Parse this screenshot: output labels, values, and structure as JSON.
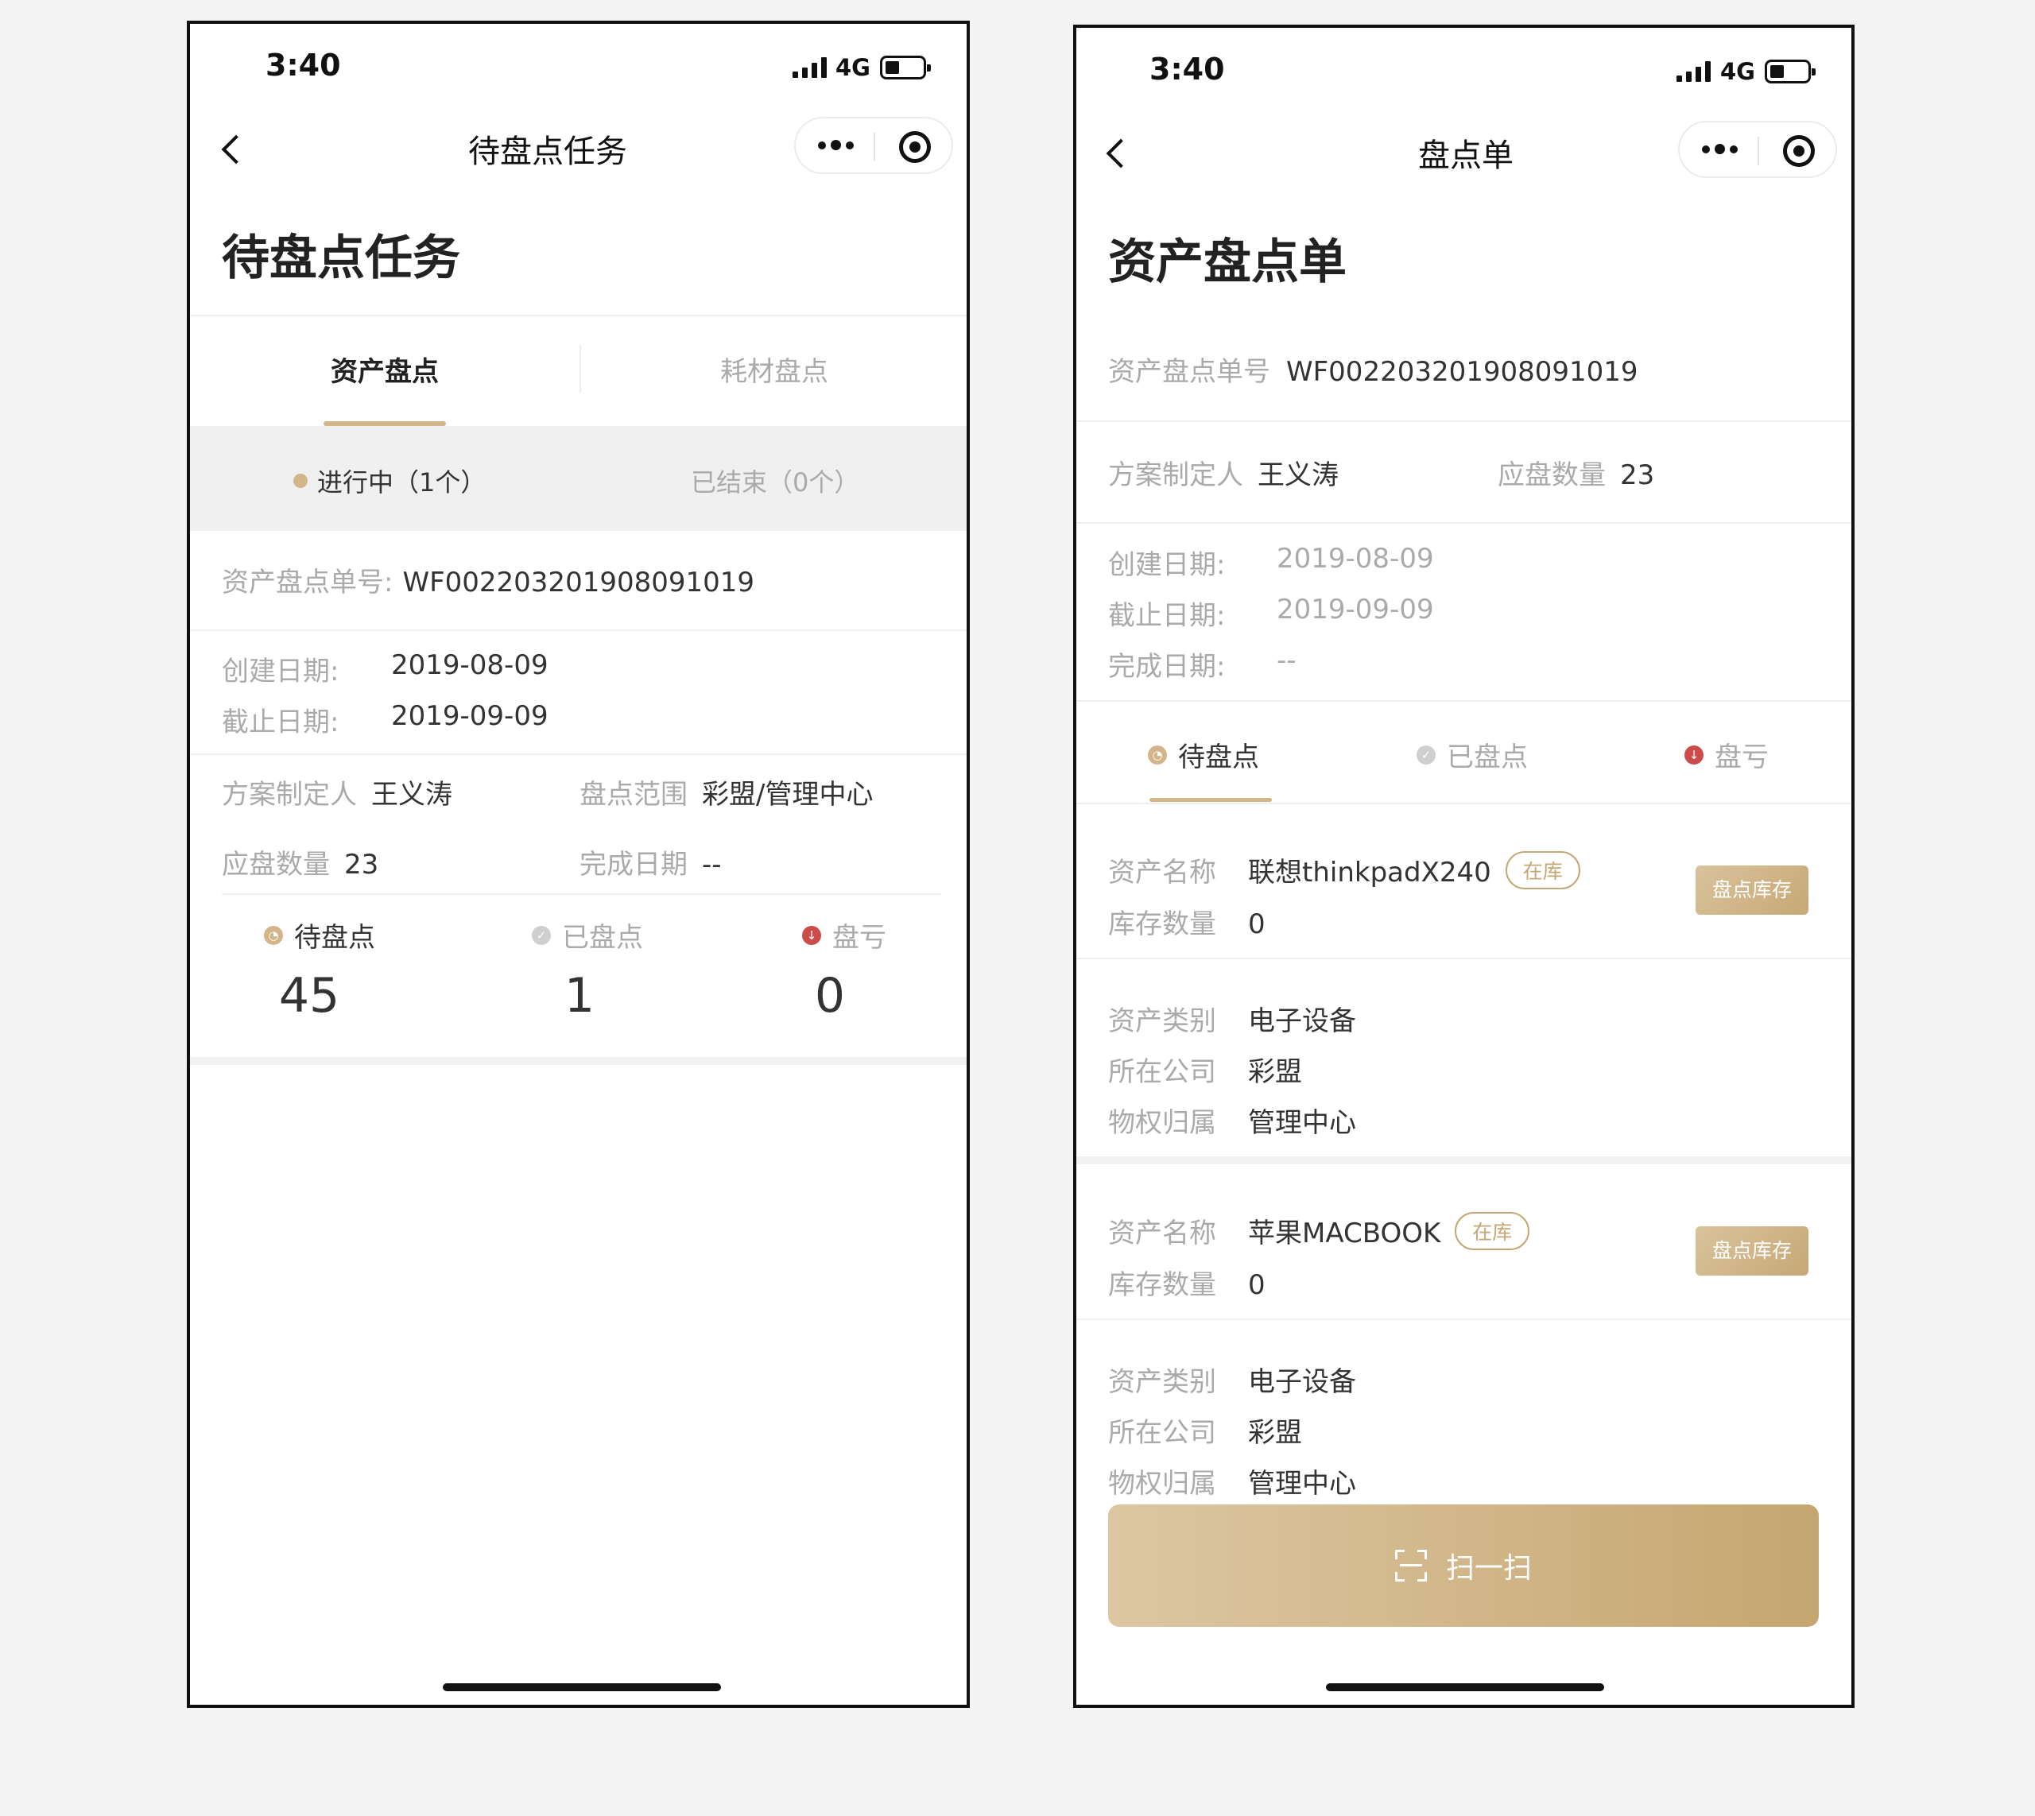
{
  "left": {
    "status": {
      "time": "3:40",
      "network": "4G"
    },
    "nav": {
      "title": "待盘点任务"
    },
    "page_title": "待盘点任务",
    "tabs": [
      {
        "label": "资产盘点"
      },
      {
        "label": "耗材盘点"
      }
    ],
    "filters": [
      {
        "label": "进行中（1个）"
      },
      {
        "label": "已结束（0个）"
      }
    ],
    "order": {
      "label": "资产盘点单号:",
      "value": "WF002203201908091019"
    },
    "created": {
      "label": "创建日期:",
      "value": "2019-08-09"
    },
    "deadline": {
      "label": "截止日期:",
      "value": "2019-09-09"
    },
    "planner": {
      "label": "方案制定人",
      "value": "王义涛"
    },
    "scope": {
      "label": "盘点范围",
      "value": "彩盟/管理中心"
    },
    "quantity": {
      "label": "应盘数量",
      "value": "23"
    },
    "finished": {
      "label": "完成日期",
      "value": "--"
    },
    "stats": [
      {
        "label": "待盘点",
        "value": "45",
        "color": "#d2b68a"
      },
      {
        "label": "已盘点",
        "value": "1",
        "color": "#cfcfcf"
      },
      {
        "label": "盘亏",
        "value": "0",
        "color": "#cc4b4b"
      }
    ]
  },
  "right": {
    "status": {
      "time": "3:40",
      "network": "4G"
    },
    "nav": {
      "title": "盘点单"
    },
    "page_title": "资产盘点单",
    "order": {
      "label": "资产盘点单号",
      "value": "WF002203201908091019"
    },
    "planner": {
      "label": "方案制定人",
      "value": "王义涛"
    },
    "quantity": {
      "label": "应盘数量",
      "value": "23"
    },
    "created": {
      "label": "创建日期:",
      "value": "2019-08-09"
    },
    "deadline": {
      "label": "截止日期:",
      "value": "2019-09-09"
    },
    "finished": {
      "label": "完成日期:",
      "value": "--"
    },
    "tabs": [
      {
        "label": "待盘点"
      },
      {
        "label": "已盘点"
      },
      {
        "label": "盘亏"
      }
    ],
    "assets": [
      {
        "name_label": "资产名称",
        "name": "联想thinkpadX240",
        "badge": "在库",
        "stock_label": "库存数量",
        "stock": "0",
        "button": "盘点库存",
        "category_label": "资产类别",
        "category": "电子设备",
        "company_label": "所在公司",
        "company": "彩盟",
        "owner_label": "物权归属",
        "owner": "管理中心"
      },
      {
        "name_label": "资产名称",
        "name": "苹果MACBOOK",
        "badge": "在库",
        "stock_label": "库存数量",
        "stock": "0",
        "button": "盘点库存",
        "category_label": "资产类别",
        "category": "电子设备",
        "company_label": "所在公司",
        "company": "彩盟",
        "owner_label": "物权归属",
        "owner": "管理中心"
      }
    ],
    "scan_button": "扫一扫"
  },
  "colors": {
    "accent": "#c5a774",
    "pending": "#d2b68a",
    "done": "#cfcfcf",
    "loss": "#cc4b4b"
  }
}
